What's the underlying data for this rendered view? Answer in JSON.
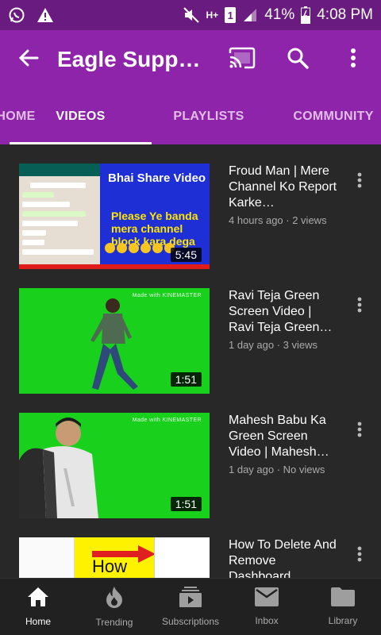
{
  "status_bar": {
    "battery": "41%",
    "time": "4:08 PM",
    "network": "H+",
    "sim": "1",
    "icons": [
      "whatsapp-icon",
      "warning-icon",
      "mute-icon",
      "signal-icon",
      "battery-icon"
    ]
  },
  "app_bar": {
    "title": "Eagle Supp…",
    "icons": [
      "back-arrow-icon",
      "cast-icon",
      "search-icon",
      "more-vert-icon"
    ]
  },
  "tabs": [
    {
      "label": "HOME",
      "active": false
    },
    {
      "label": "VIDEOS",
      "active": true
    },
    {
      "label": "PLAYLISTS",
      "active": false
    },
    {
      "label": "COMMUNITY",
      "active": false
    }
  ],
  "videos": [
    {
      "title": "Froud Man | Mere Channel Ko Report Karke…",
      "meta": "4 hours ago · 2 views",
      "duration": "5:45",
      "thumb_heading": "Bhai Share Video",
      "thumb_text": "Please  Ye banda mera channel block kara dega"
    },
    {
      "title": "Ravi Teja Green Screen Video | Ravi Teja Green…",
      "meta": "1 day ago · 3 views",
      "duration": "1:51",
      "watermark": "Made with KINEMASTER"
    },
    {
      "title": "Mahesh Babu Ka Green Screen Video | Mahesh…",
      "meta": "1 day ago · No views",
      "duration": "1:51",
      "watermark": "Made with KINEMASTER"
    },
    {
      "title": "How To Delete And Remove Dashboard",
      "meta": "",
      "duration": "",
      "thumb_text": "How"
    }
  ],
  "bottom_nav": [
    {
      "label": "Home",
      "icon": "home-icon",
      "active": true
    },
    {
      "label": "Trending",
      "icon": "trending-icon",
      "active": false
    },
    {
      "label": "Subscriptions",
      "icon": "subscriptions-icon",
      "active": false
    },
    {
      "label": "Inbox",
      "icon": "inbox-icon",
      "active": false
    },
    {
      "label": "Library",
      "icon": "library-icon",
      "active": false
    }
  ],
  "colors": {
    "status_bar": "#6a1b7f",
    "app_bar": "#8e24aa",
    "background": "#282828",
    "nav_background": "#212121"
  }
}
